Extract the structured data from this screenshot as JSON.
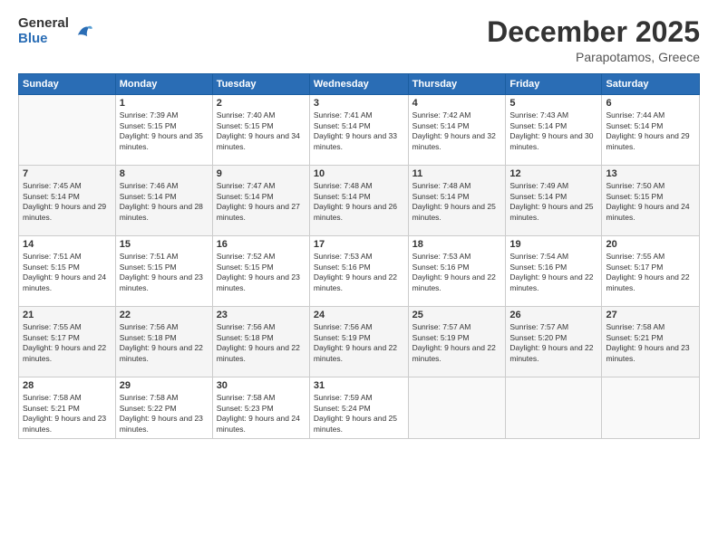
{
  "logo": {
    "general": "General",
    "blue": "Blue"
  },
  "header": {
    "title": "December 2025",
    "subtitle": "Parapotamos, Greece"
  },
  "weekdays": [
    "Sunday",
    "Monday",
    "Tuesday",
    "Wednesday",
    "Thursday",
    "Friday",
    "Saturday"
  ],
  "weeks": [
    [
      {
        "day": "",
        "sunrise": "",
        "sunset": "",
        "daylight": ""
      },
      {
        "day": "1",
        "sunrise": "Sunrise: 7:39 AM",
        "sunset": "Sunset: 5:15 PM",
        "daylight": "Daylight: 9 hours and 35 minutes."
      },
      {
        "day": "2",
        "sunrise": "Sunrise: 7:40 AM",
        "sunset": "Sunset: 5:15 PM",
        "daylight": "Daylight: 9 hours and 34 minutes."
      },
      {
        "day": "3",
        "sunrise": "Sunrise: 7:41 AM",
        "sunset": "Sunset: 5:14 PM",
        "daylight": "Daylight: 9 hours and 33 minutes."
      },
      {
        "day": "4",
        "sunrise": "Sunrise: 7:42 AM",
        "sunset": "Sunset: 5:14 PM",
        "daylight": "Daylight: 9 hours and 32 minutes."
      },
      {
        "day": "5",
        "sunrise": "Sunrise: 7:43 AM",
        "sunset": "Sunset: 5:14 PM",
        "daylight": "Daylight: 9 hours and 30 minutes."
      },
      {
        "day": "6",
        "sunrise": "Sunrise: 7:44 AM",
        "sunset": "Sunset: 5:14 PM",
        "daylight": "Daylight: 9 hours and 29 minutes."
      }
    ],
    [
      {
        "day": "7",
        "sunrise": "Sunrise: 7:45 AM",
        "sunset": "Sunset: 5:14 PM",
        "daylight": "Daylight: 9 hours and 29 minutes."
      },
      {
        "day": "8",
        "sunrise": "Sunrise: 7:46 AM",
        "sunset": "Sunset: 5:14 PM",
        "daylight": "Daylight: 9 hours and 28 minutes."
      },
      {
        "day": "9",
        "sunrise": "Sunrise: 7:47 AM",
        "sunset": "Sunset: 5:14 PM",
        "daylight": "Daylight: 9 hours and 27 minutes."
      },
      {
        "day": "10",
        "sunrise": "Sunrise: 7:48 AM",
        "sunset": "Sunset: 5:14 PM",
        "daylight": "Daylight: 9 hours and 26 minutes."
      },
      {
        "day": "11",
        "sunrise": "Sunrise: 7:48 AM",
        "sunset": "Sunset: 5:14 PM",
        "daylight": "Daylight: 9 hours and 25 minutes."
      },
      {
        "day": "12",
        "sunrise": "Sunrise: 7:49 AM",
        "sunset": "Sunset: 5:14 PM",
        "daylight": "Daylight: 9 hours and 25 minutes."
      },
      {
        "day": "13",
        "sunrise": "Sunrise: 7:50 AM",
        "sunset": "Sunset: 5:15 PM",
        "daylight": "Daylight: 9 hours and 24 minutes."
      }
    ],
    [
      {
        "day": "14",
        "sunrise": "Sunrise: 7:51 AM",
        "sunset": "Sunset: 5:15 PM",
        "daylight": "Daylight: 9 hours and 24 minutes."
      },
      {
        "day": "15",
        "sunrise": "Sunrise: 7:51 AM",
        "sunset": "Sunset: 5:15 PM",
        "daylight": "Daylight: 9 hours and 23 minutes."
      },
      {
        "day": "16",
        "sunrise": "Sunrise: 7:52 AM",
        "sunset": "Sunset: 5:15 PM",
        "daylight": "Daylight: 9 hours and 23 minutes."
      },
      {
        "day": "17",
        "sunrise": "Sunrise: 7:53 AM",
        "sunset": "Sunset: 5:16 PM",
        "daylight": "Daylight: 9 hours and 22 minutes."
      },
      {
        "day": "18",
        "sunrise": "Sunrise: 7:53 AM",
        "sunset": "Sunset: 5:16 PM",
        "daylight": "Daylight: 9 hours and 22 minutes."
      },
      {
        "day": "19",
        "sunrise": "Sunrise: 7:54 AM",
        "sunset": "Sunset: 5:16 PM",
        "daylight": "Daylight: 9 hours and 22 minutes."
      },
      {
        "day": "20",
        "sunrise": "Sunrise: 7:55 AM",
        "sunset": "Sunset: 5:17 PM",
        "daylight": "Daylight: 9 hours and 22 minutes."
      }
    ],
    [
      {
        "day": "21",
        "sunrise": "Sunrise: 7:55 AM",
        "sunset": "Sunset: 5:17 PM",
        "daylight": "Daylight: 9 hours and 22 minutes."
      },
      {
        "day": "22",
        "sunrise": "Sunrise: 7:56 AM",
        "sunset": "Sunset: 5:18 PM",
        "daylight": "Daylight: 9 hours and 22 minutes."
      },
      {
        "day": "23",
        "sunrise": "Sunrise: 7:56 AM",
        "sunset": "Sunset: 5:18 PM",
        "daylight": "Daylight: 9 hours and 22 minutes."
      },
      {
        "day": "24",
        "sunrise": "Sunrise: 7:56 AM",
        "sunset": "Sunset: 5:19 PM",
        "daylight": "Daylight: 9 hours and 22 minutes."
      },
      {
        "day": "25",
        "sunrise": "Sunrise: 7:57 AM",
        "sunset": "Sunset: 5:19 PM",
        "daylight": "Daylight: 9 hours and 22 minutes."
      },
      {
        "day": "26",
        "sunrise": "Sunrise: 7:57 AM",
        "sunset": "Sunset: 5:20 PM",
        "daylight": "Daylight: 9 hours and 22 minutes."
      },
      {
        "day": "27",
        "sunrise": "Sunrise: 7:58 AM",
        "sunset": "Sunset: 5:21 PM",
        "daylight": "Daylight: 9 hours and 23 minutes."
      }
    ],
    [
      {
        "day": "28",
        "sunrise": "Sunrise: 7:58 AM",
        "sunset": "Sunset: 5:21 PM",
        "daylight": "Daylight: 9 hours and 23 minutes."
      },
      {
        "day": "29",
        "sunrise": "Sunrise: 7:58 AM",
        "sunset": "Sunset: 5:22 PM",
        "daylight": "Daylight: 9 hours and 23 minutes."
      },
      {
        "day": "30",
        "sunrise": "Sunrise: 7:58 AM",
        "sunset": "Sunset: 5:23 PM",
        "daylight": "Daylight: 9 hours and 24 minutes."
      },
      {
        "day": "31",
        "sunrise": "Sunrise: 7:59 AM",
        "sunset": "Sunset: 5:24 PM",
        "daylight": "Daylight: 9 hours and 25 minutes."
      },
      {
        "day": "",
        "sunrise": "",
        "sunset": "",
        "daylight": ""
      },
      {
        "day": "",
        "sunrise": "",
        "sunset": "",
        "daylight": ""
      },
      {
        "day": "",
        "sunrise": "",
        "sunset": "",
        "daylight": ""
      }
    ]
  ]
}
